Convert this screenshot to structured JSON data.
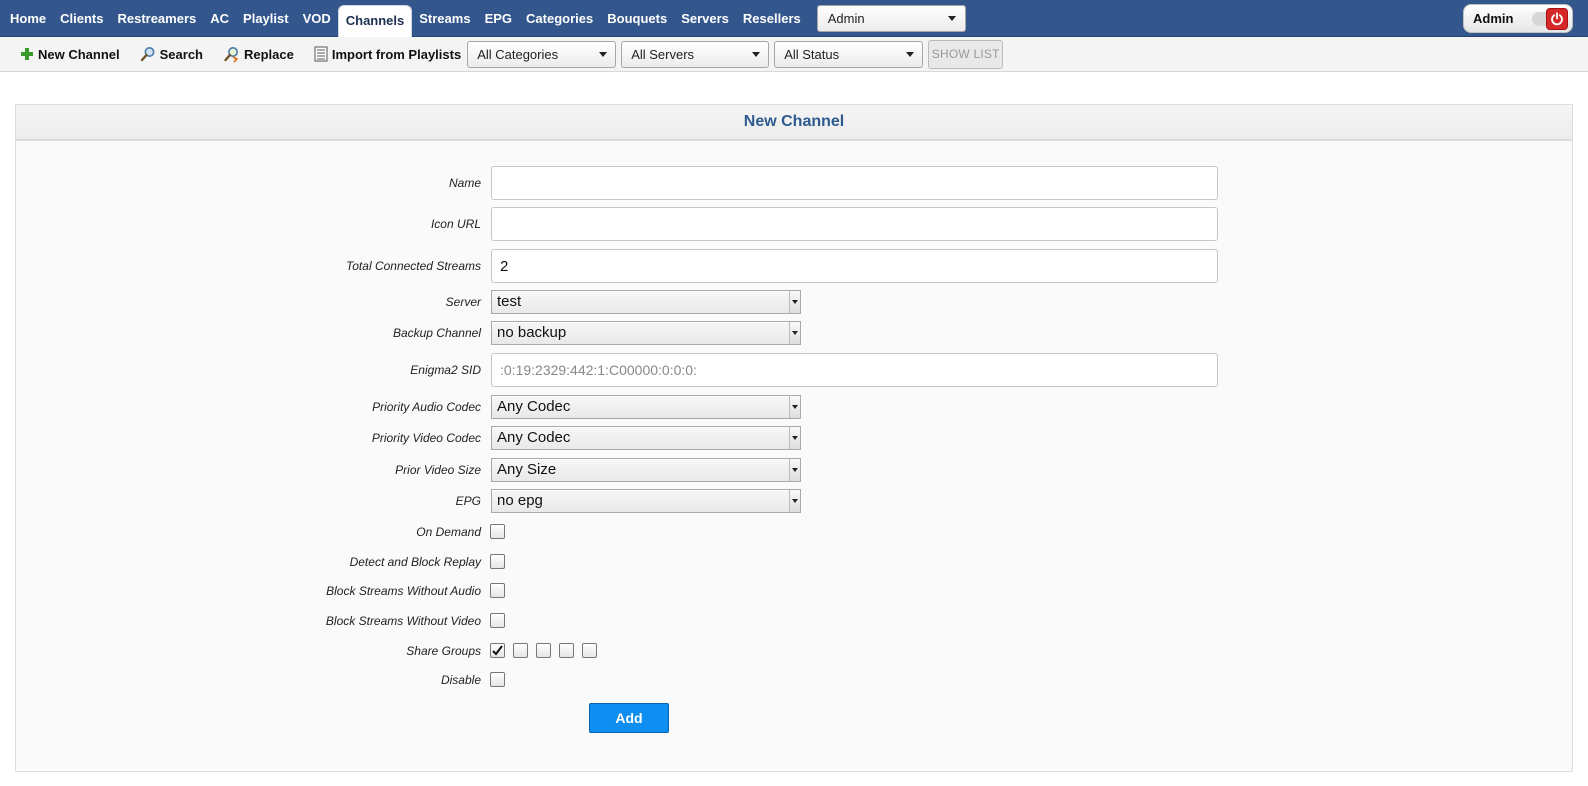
{
  "nav": {
    "items": [
      "Home",
      "Clients",
      "Restreamers",
      "AC",
      "Playlist",
      "VOD",
      "Channels",
      "Streams",
      "EPG",
      "Categories",
      "Bouquets",
      "Servers",
      "Resellers"
    ],
    "active": "Channels",
    "role_select": "Admin",
    "user": "Admin",
    "power_icon": "power-icon"
  },
  "toolbar": {
    "new_channel": "New Channel",
    "search": "Search",
    "replace": "Replace",
    "import": "Import from Playlists",
    "categories_filter": "All Categories",
    "servers_filter": "All Servers",
    "status_filter": "All Status",
    "show_list": "SHOW LIST"
  },
  "panel": {
    "title": "New Channel"
  },
  "form": {
    "name_label": "Name",
    "name_value": "",
    "icon_url_label": "Icon URL",
    "icon_url_value": "",
    "total_streams_label": "Total Connected Streams",
    "total_streams_value": "2",
    "server_label": "Server",
    "server_value": "test",
    "backup_label": "Backup Channel",
    "backup_value": "no backup",
    "enigma_label": "Enigma2 SID",
    "enigma_placeholder": ":0:19:2329:442:1:C00000:0:0:0:",
    "audio_label": "Priority Audio Codec",
    "audio_value": "Any Codec",
    "video_label": "Priority Video Codec",
    "video_value": "Any Codec",
    "size_label": "Prior Video Size",
    "size_value": "Any Size",
    "epg_label": "EPG",
    "epg_value": "no epg",
    "on_demand_label": "On Demand",
    "detect_replay_label": "Detect and Block Replay",
    "no_audio_label": "Block Streams Without Audio",
    "no_video_label": "Block Streams Without Video",
    "share_groups_label": "Share Groups",
    "share_groups_checked": [
      true,
      false,
      false,
      false,
      false
    ],
    "disable_label": "Disable",
    "add_button": "Add"
  },
  "colors": {
    "nav_bg": "#33578c",
    "title": "#2e5a8f",
    "add_button": "#0e8ef0",
    "power": "#d62828"
  }
}
